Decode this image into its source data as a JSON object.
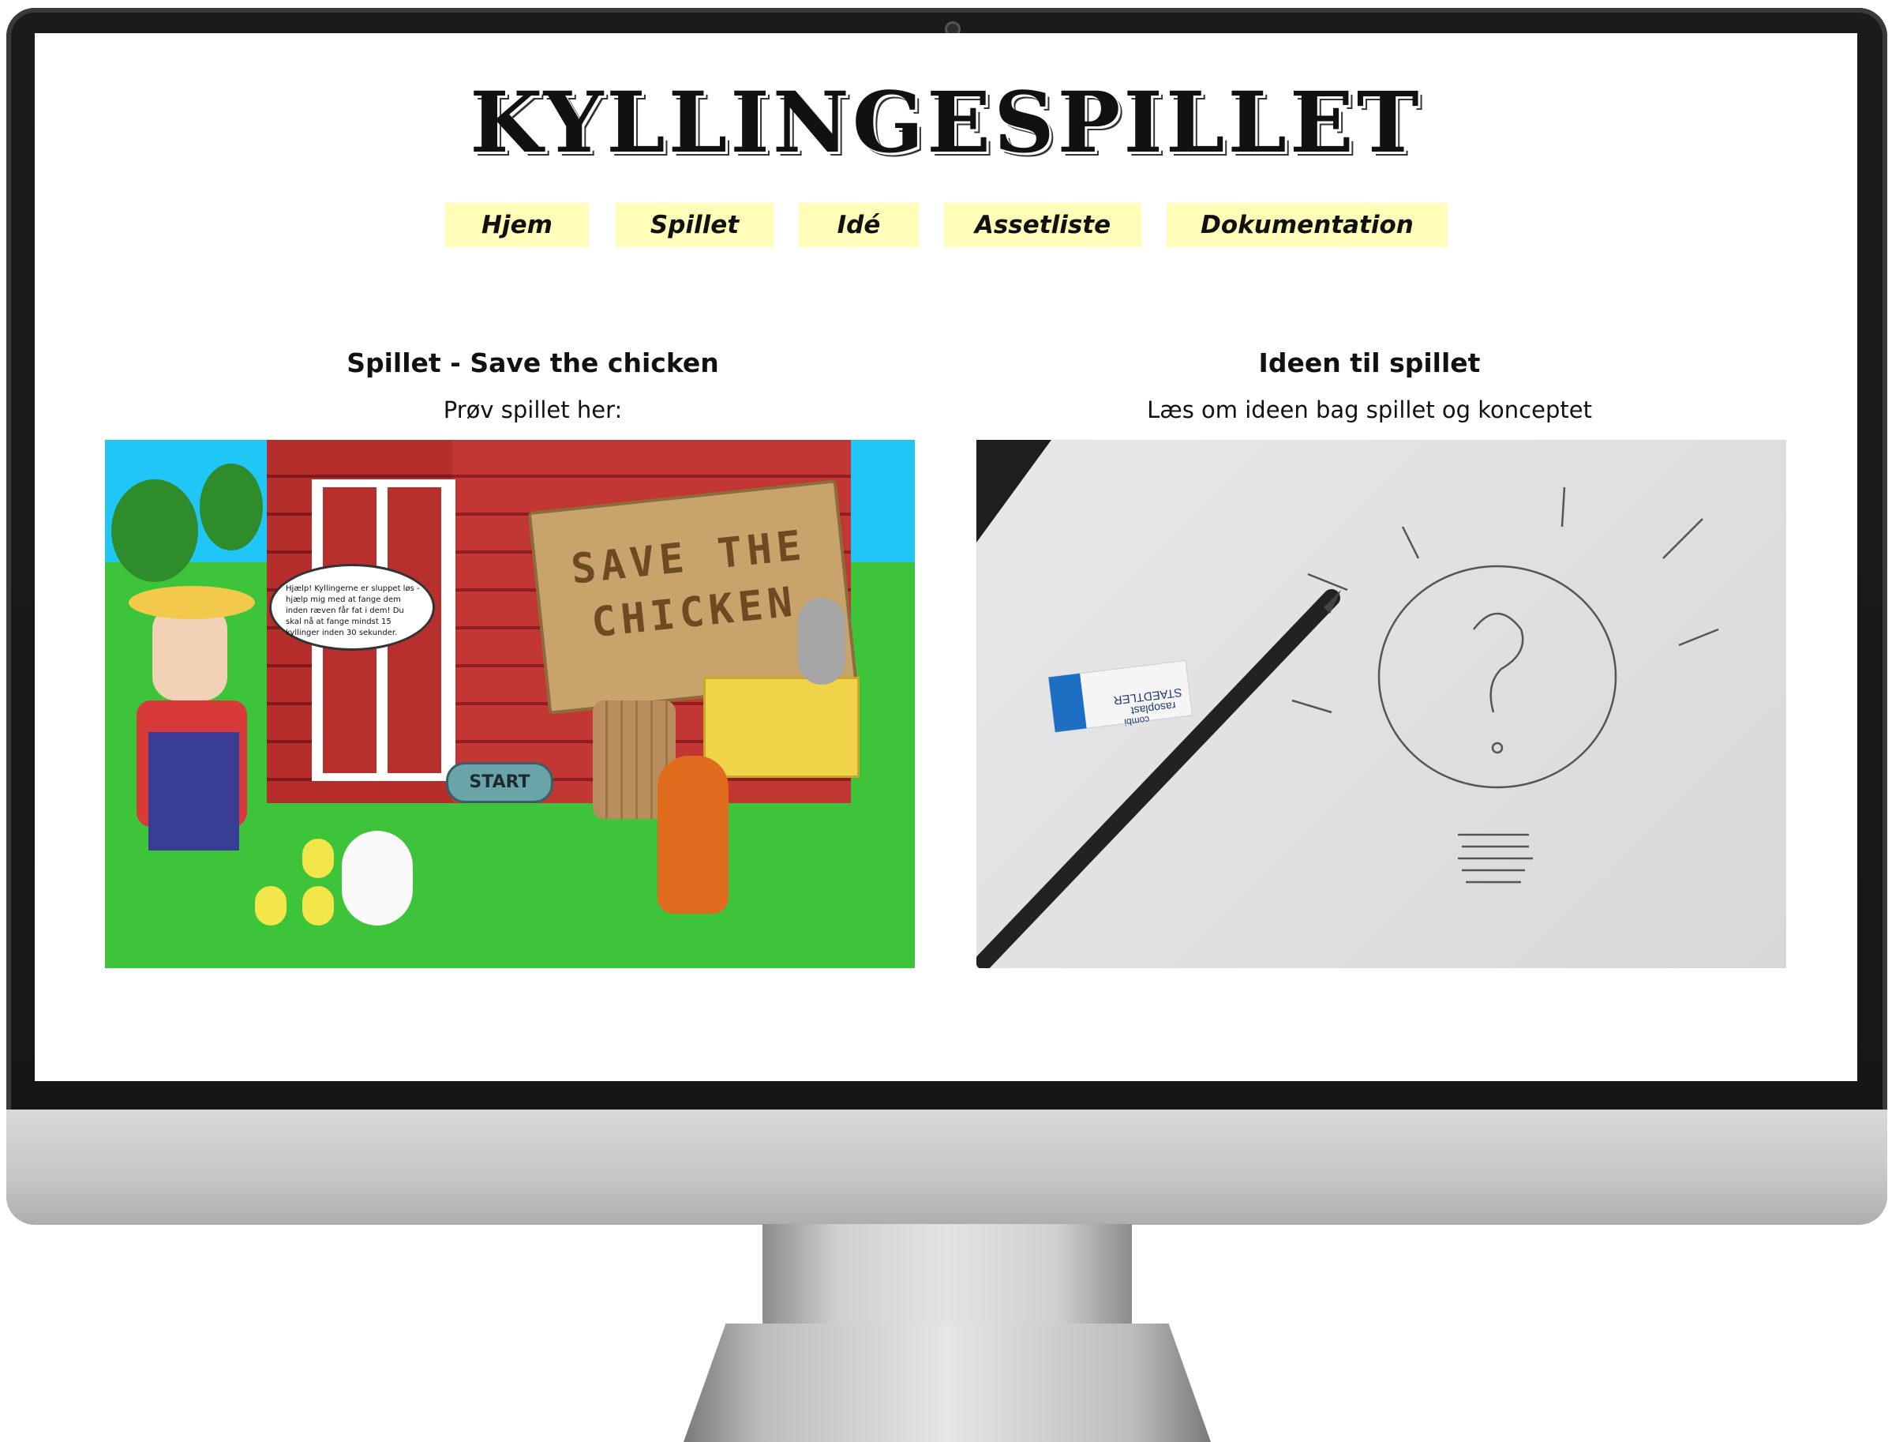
{
  "site": {
    "title": "KYLLINGESPILLET"
  },
  "nav": {
    "items": [
      {
        "label": "Hjem"
      },
      {
        "label": "Spillet"
      },
      {
        "label": "Idé"
      },
      {
        "label": "Assetliste"
      },
      {
        "label": "Dokumentation"
      }
    ]
  },
  "game_card": {
    "heading": "Spillet - Save the chicken",
    "subtitle": "Prøv spillet her:",
    "image": {
      "sign_line1": "SAVE THE",
      "sign_line2": "CHICKEN",
      "speech": "Hjælp! Kyllingerne er sluppet løs - hjælp mig med at fange dem inden ræven får fat i dem! Du skal nå at fange mindst 15 kyllinger inden 30 sekunder.",
      "start_label": "START"
    }
  },
  "idea_card": {
    "heading": "Ideen til spillet",
    "subtitle": "Læs om ideen bag spillet og konceptet",
    "image": {
      "eraser_line1": "STAEDTLER",
      "eraser_line2": "rasoplast",
      "eraser_line3": "combi"
    }
  },
  "colors": {
    "nav_bg": "#fffdb8",
    "grass": "#3ec43a",
    "sky": "#20c6f5",
    "barn": "#c23634"
  }
}
